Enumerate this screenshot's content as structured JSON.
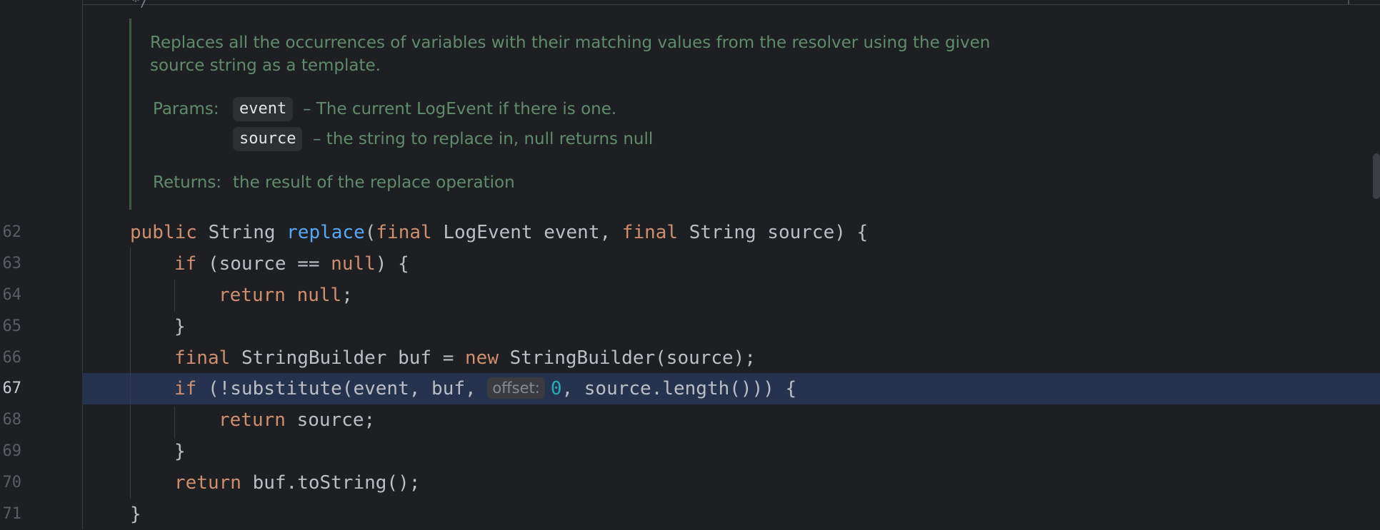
{
  "editor": {
    "top_fragment": "*/",
    "doc": {
      "description_line1": "Replaces all the occurrences of variables with their matching values from the resolver using the given",
      "description_line2": "source string as a template.",
      "params_label": "Params:",
      "params": [
        {
          "name": "event",
          "desc": "– The current LogEvent if there is one."
        },
        {
          "name": "source",
          "desc": "– the string to replace in, null returns null"
        }
      ],
      "returns_label": "Returns:",
      "returns_desc": "the result of the replace operation"
    },
    "line_numbers": [
      "62",
      "63",
      "64",
      "65",
      "66",
      "67",
      "68",
      "69",
      "70",
      "71"
    ],
    "active_line": "67",
    "code": {
      "l62": {
        "public": "public",
        "type1": "String",
        "method": "replace",
        "p1": "(",
        "final1": "final",
        "mid1": "LogEvent event,",
        "final2": "final",
        "end": "String source) {"
      },
      "l63": {
        "kw": "if",
        "a": "(source ==",
        "null": "null",
        "b": ") {"
      },
      "l64": {
        "kw": "return",
        "null": "null",
        "semi": ";"
      },
      "l65": {
        "brace": "}"
      },
      "l66": {
        "final": "final",
        "a": "StringBuilder buf =",
        "new": "new",
        "b": "StringBuilder(source);"
      },
      "l67": {
        "kw": "if",
        "a": "(!substitute(event, buf,",
        "hint": "offset:",
        "num": "0",
        "b": ", source.length())) {"
      },
      "l68": {
        "kw": "return",
        "a": "source;"
      },
      "l69": {
        "brace": "}"
      },
      "l70": {
        "kw": "return",
        "a": "buf.toString();"
      },
      "l71": {
        "brace": "}"
      }
    }
  },
  "colors": {
    "background": "#1e1f22",
    "keyword": "#cf8e6d",
    "method": "#56a8f5",
    "number": "#2aacb8",
    "doc_text": "#5f8c6a",
    "caret_line": "#25334e"
  }
}
